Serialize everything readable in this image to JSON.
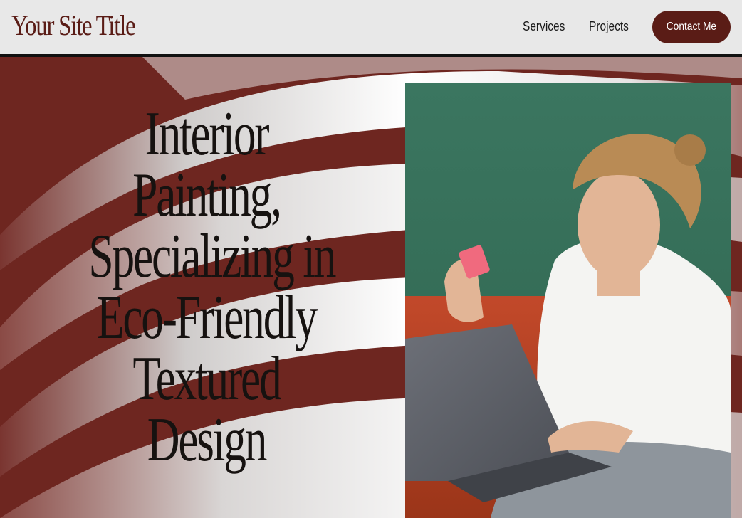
{
  "header": {
    "site_title": "Your Site Title",
    "nav": [
      {
        "label": "Services"
      },
      {
        "label": "Projects"
      }
    ],
    "cta_label": "Contact Me"
  },
  "hero": {
    "headline_lines": [
      "Interior",
      "Painting,",
      "Specializing in",
      "Eco-Friendly",
      "Textured",
      "Design"
    ],
    "photo_icon": "woman-with-laptop-photo"
  },
  "colors": {
    "brand": "#5a1c16",
    "header_bg": "#e8e8e8",
    "hero_dark": "#6e2620"
  }
}
